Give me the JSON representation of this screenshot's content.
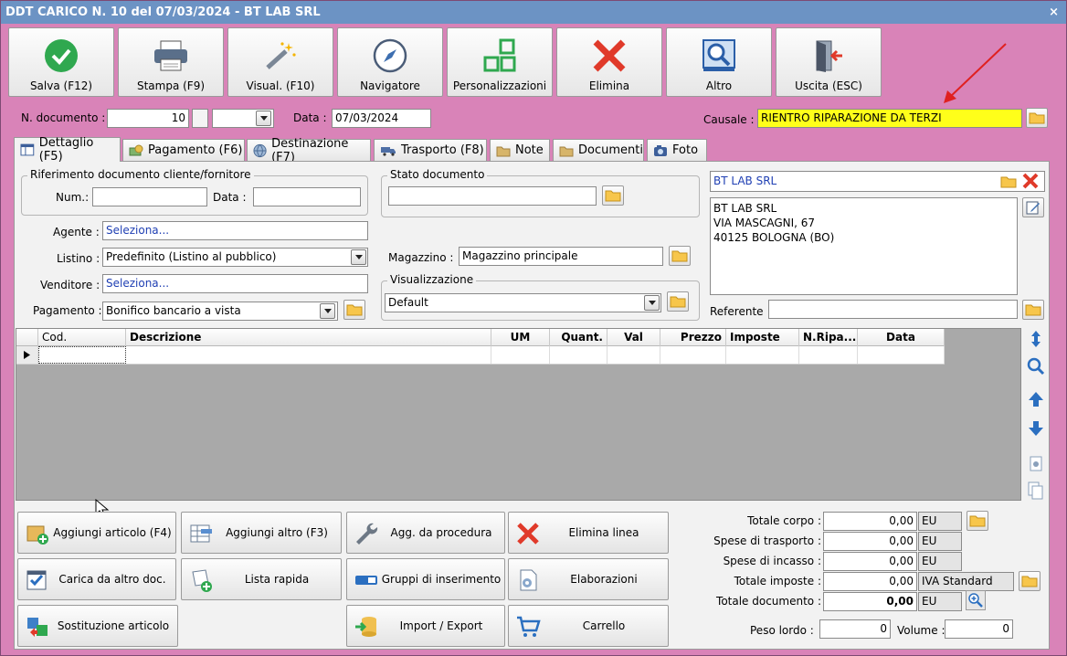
{
  "window": {
    "title": "DDT CARICO N. 10 del 07/03/2024 - BT LAB SRL",
    "close": "×"
  },
  "toolbar": [
    {
      "label": "Salva (F12)",
      "icon": "check-icon"
    },
    {
      "label": "Stampa (F9)",
      "icon": "printer-icon"
    },
    {
      "label": "Visual. (F10)",
      "icon": "magic-wand-icon"
    },
    {
      "label": "Navigatore",
      "icon": "compass-icon"
    },
    {
      "label": "Personalizzazioni",
      "icon": "blocks-icon"
    },
    {
      "label": "Elimina",
      "icon": "red-x-icon"
    },
    {
      "label": "Altro",
      "icon": "magnifier-icon"
    },
    {
      "label": "Uscita (ESC)",
      "icon": "exit-door-icon"
    }
  ],
  "header": {
    "doc_number_label": "N. documento :",
    "doc_number": "10",
    "date_label": "Data :",
    "date": "07/03/2024",
    "causale_label": "Causale :",
    "causale": "RIENTRO RIPARAZIONE DA TERZI"
  },
  "tabs": [
    {
      "label": "Dettaglio (F5)",
      "icon": "table-icon"
    },
    {
      "label": "Pagamento (F6)",
      "icon": "money-icon"
    },
    {
      "label": "Destinazione (F7)",
      "icon": "globe-icon"
    },
    {
      "label": "Trasporto (F8)",
      "icon": "truck-icon"
    },
    {
      "label": "Note",
      "icon": "notes-icon"
    },
    {
      "label": "Documenti",
      "icon": "folder-icon"
    },
    {
      "label": "Foto",
      "icon": "camera-icon"
    }
  ],
  "detail": {
    "rif_group": "Riferimento documento cliente/fornitore",
    "num_label": "Num.:",
    "num_value": "",
    "data_label": "Data :",
    "data_value": "",
    "stato_group": "Stato documento",
    "stato_value": "",
    "agente_label": "Agente :",
    "agente_value": "Seleziona...",
    "listino_label": "Listino :",
    "listino_value": "Predefinito (Listino al pubblico)",
    "venditore_label": "Venditore :",
    "venditore_value": "Seleziona...",
    "pagamento_label": "Pagamento :",
    "pagamento_value": "Bonifico bancario a vista",
    "magazzino_label": "Magazzino :",
    "magazzino_value": "Magazzino principale",
    "visual_group": "Visualizzazione",
    "visual_value": "Default"
  },
  "customer": {
    "name": "BT LAB SRL",
    "address": [
      "BT LAB SRL",
      "VIA MASCAGNI, 67",
      "40125 BOLOGNA (BO)"
    ],
    "referente_label": "Referente",
    "referente_value": ""
  },
  "grid": {
    "columns": [
      "Cod.",
      "Descrizione",
      "UM",
      "Quant.",
      "Val",
      "Prezzo",
      "Imposte",
      "N.Ripa...",
      "Data"
    ]
  },
  "actions": [
    {
      "label": "Aggiungi articolo (F4)",
      "icon": "add-item-icon"
    },
    {
      "label": "Aggiungi altro (F3)",
      "icon": "add-other-icon"
    },
    {
      "label": "Agg. da procedura",
      "icon": "wrench-icon"
    },
    {
      "label": "Elimina linea",
      "icon": "delete-line-icon"
    },
    {
      "label": "Carica da altro doc.",
      "icon": "load-doc-icon"
    },
    {
      "label": "Lista rapida",
      "icon": "quick-list-icon"
    },
    {
      "label": "Gruppi di inserimento",
      "icon": "groups-icon"
    },
    {
      "label": "Elaborazioni",
      "icon": "processing-icon"
    },
    {
      "label": "Sostituzione articolo",
      "icon": "replace-icon"
    },
    {
      "label": "Import / Export",
      "icon": "import-export-icon"
    },
    {
      "label": "Carrello",
      "icon": "cart-icon"
    }
  ],
  "totals": {
    "corpo_label": "Totale corpo :",
    "corpo": "0,00",
    "corpo_cur": "EU",
    "trasporto_label": "Spese di trasporto :",
    "trasporto": "0,00",
    "trasporto_cur": "EU",
    "incasso_label": "Spese di incasso :",
    "incasso": "0,00",
    "incasso_cur": "EU",
    "imposte_label": "Totale imposte :",
    "imposte": "0,00",
    "imposte_type": "IVA Standard",
    "documento_label": "Totale documento :",
    "documento": "0,00",
    "documento_cur": "EU",
    "peso_label": "Peso lordo :",
    "peso": "0",
    "volume_label": "Volume :",
    "volume": "0"
  },
  "colors": {
    "background": "#d983b8",
    "titlebar": "#6c93c4",
    "highlight": "#ffff1a",
    "annotation_arrow": "#e02020"
  }
}
